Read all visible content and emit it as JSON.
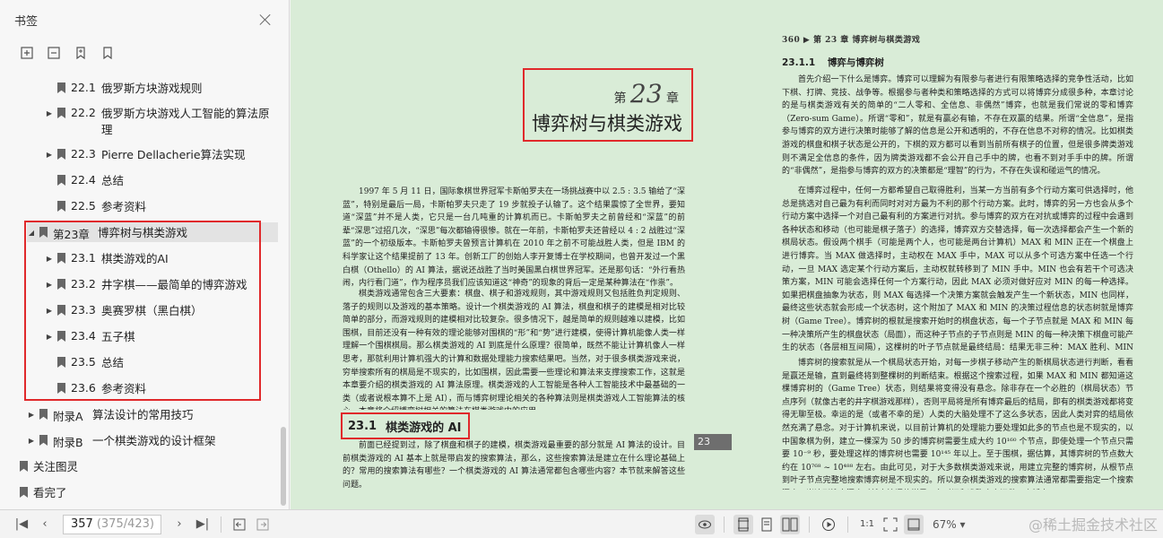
{
  "sidebar": {
    "title": "书签",
    "tools": [
      "expand-all-icon",
      "collapse-all-icon",
      "add-bookmark-icon",
      "bookmark-icon"
    ],
    "items": [
      {
        "num": "22.1",
        "label": "俄罗斯方块游戏规则",
        "level": 2,
        "arrow": false
      },
      {
        "num": "22.2",
        "label": "俄罗斯方块游戏人工智能的算法原理",
        "level": 2,
        "arrow": true
      },
      {
        "num": "22.3",
        "label": "Pierre Dellacherie算法实现",
        "level": 2,
        "arrow": true
      },
      {
        "num": "22.4",
        "label": "总结",
        "level": 2,
        "arrow": false
      },
      {
        "num": "22.5",
        "label": "参考资料",
        "level": 2,
        "arrow": false
      },
      {
        "num": "第23章",
        "label": "博弈树与棋类游戏",
        "level": 1,
        "arrow": "down",
        "selected": true
      },
      {
        "num": "23.1",
        "label": "棋类游戏的AI",
        "level": 2,
        "arrow": true
      },
      {
        "num": "23.2",
        "label": "井字棋——最简单的博弈游戏",
        "level": 2,
        "arrow": true
      },
      {
        "num": "23.3",
        "label": "奥赛罗棋（黑白棋）",
        "level": 2,
        "arrow": true
      },
      {
        "num": "23.4",
        "label": "五子棋",
        "level": 2,
        "arrow": true
      },
      {
        "num": "23.5",
        "label": "总结",
        "level": 2,
        "arrow": false
      },
      {
        "num": "23.6",
        "label": "参考资料",
        "level": 2,
        "arrow": false
      },
      {
        "num": "附录A",
        "label": "算法设计的常用技巧",
        "level": 1,
        "arrow": true
      },
      {
        "num": "附录B",
        "label": "一个棋类游戏的设计框架",
        "level": 1,
        "arrow": true
      },
      {
        "num": "",
        "label": "关注图灵",
        "level": 0,
        "arrow": false
      },
      {
        "num": "",
        "label": "看完了",
        "level": 0,
        "arrow": false
      }
    ]
  },
  "doc": {
    "chapter_prefix": "第",
    "chapter_num": "23",
    "chapter_suffix": "章",
    "chapter_title": "博弈树与棋类游戏",
    "left_paragraphs": [
      "1997 年 5 月 11 日，国际象棋世界冠军卡斯帕罗夫在一场挑战赛中以 2.5 : 3.5 输给了“深蓝”，特别是最后一局，卡斯帕罗夫只走了 19 步就投子认输了。这个结果震惊了全世界，要知道“深蓝”并不是人类，它只是一台几吨重的计算机而已。卡斯帕罗夫之前曾经和“深蓝”的前辈“深思”过招几次，“深思”每次都输得很惨。就在一年前，卡斯帕罗夫还曾经以 4 : 2 战胜过“深蓝”的一个初级版本。卡斯帕罗夫曾预言计算机在 2010 年之前不可能战胜人类，但是 IBM 的科学家让这个结果提前了 13 年。创新工厂的创始人李开复博士在学校期间，也曾开发过一个黑白棋（Othello）的 AI 算法，据说还战胜了当时美国黑白棋世界冠军。还是那句话：“外行看热闹，内行看门道”，作为程序员我们应该知道这“神奇”的现象的背后一定是某种算法在“作祟”。",
      "棋类游戏通常包含三大要素：棋盘、棋子和游戏规则，其中游戏规则又包括胜负判定规则、落子的规则以及游戏的基本策略。设计一个棋类游戏的 AI 算法，棋盘和棋子的建模是相对比较简单的部分，而游戏规则的建模相对比较复杂。很多情况下，越是简单的规则越难以建模，比如围棋，目前还没有一种有效的理论能够对围棋的“形”和“势”进行建模，使得计算机能像人类一样理解一个围棋棋局。那么棋类游戏的 AI 到底是什么原理？很简单，既然不能让计算机像人一样思考，那就利用计算机强大的计算和数据处理能力搜索结果吧。当然，对于很多棋类游戏来说，穷举搜索所有的棋局是不现实的，比如围棋，因此需要一些理论和算法来支撑搜索工作，这就是本章要介绍的棋类游戏的 AI 算法原理。棋类游戏的人工智能是各种人工智能技术中最基础的一类（或者说根本算不上是 AI），而与博弈树理论相关的各种算法则是棋类游戏人工智能算法的核心，本章将介绍博弈树相关的算法在棋类游戏中的应用。"
    ],
    "section_num": "23.1",
    "section_title": "棋类游戏的 AI",
    "section_para": "前面已经提到过，除了棋盘和棋子的建模，棋类游戏最重要的部分就是 AI 算法的设计。目前棋类游戏的 AI 基本上就是带启发的搜索算法，那么，这些搜索算法是建立在什么理论基础上的？常用的搜索算法有哪些？一个棋类游戏的 AI 算法通常都包含哪些内容？本节就来解答这些问题。",
    "tab_label": "23",
    "right_header": "360  ▶  第 23 章   博弈树与棋类游戏",
    "right_section_num": "23.1.1",
    "right_section_title": "博弈与博弈树",
    "right_paragraphs": [
      "首先介绍一下什么是博弈。博弈可以理解为有限参与者进行有限策略选择的竞争性活动，比如下棋、打牌、竞技、战争等。根据参与者种类和策略选择的方式可以将博弈分成很多种，本章讨论的是与棋类游戏有关的简单的“二人零和、全信息、非偶然”博弈，也就是我们常说的零和博弈（Zero-sum Game）。所谓“零和”，就是有赢必有输，不存在双赢的结果。所谓“全信息”，是指参与博弈的双方进行决策时能够了解的信息是公开和透明的，不存在信息不对称的情况。比如棋类游戏的棋盘和棋子状态是公开的，下棋的双方都可以看到当前所有棋子的位置，但是很多牌类游戏则不满足全信息的条件，因为牌类游戏都不会公开自己手中的牌，也看不到对手手中的牌。所谓的“非偶然”，是指参与博弈的双方的决策都是“理智”的行为，不存在失误和碰运气的情况。",
      "在博弈过程中，任何一方都希望自己取得胜利，当某一方当前有多个行动方案可供选择时，他总是挑选对自己最为有利而同时对对方最为不利的那个行动方案。此时，博弈的另一方也会从多个行动方案中选择一个对自己最有利的方案进行对抗。参与博弈的双方在对抗或博弈的过程中会遇到各种状态和移动（也可能是棋子落子）的选择，博弈双方交替选择，每一次选择都会产生一个新的棋局状态。假设两个棋手（可能是两个人，也可能是两台计算机）MAX 和 MIN 正在一个棋盘上进行博弈。当 MAX 做选择时，主动权在 MAX 手中，MAX 可以从多个可选方案中任选一个行动，一旦 MAX 选定某个行动方案后，主动权就转移到了 MIN 手中。MIN 也会有若干个可选决策方案，MIN 可能会选择任何一个方案行动，因此 MAX 必须对做好应对 MIN 的每一种选择。如果把棋盘抽象为状态，则 MAX 每选择一个决策方案就会触发产生一个新状态，MIN 也同样，最终这些状态就会形成一个状态树，这个附加了 MAX 和 MIN 的决策过程信息的状态树就是博弈树（Game Tree）。博弈树的根就是搜索开始时的棋盘状态，每一个子节点就是 MAX 和 MIN 每一种决策所产生的棋盘状态（局面），而这种子节点的子节点则是 MIN 的每一种决策下棋盘可能产生的状态（各层相互间隔），这棵树的叶子节点就是最终结局：结果无非三种：MAX 胜利、MIN 胜利或者平局。",
      "博弈树的搜索就是从一个棋局状态开始，对每一步棋子移动产生的新棋局状态进行判断，看看是赢还是输，直到最终将到整棵树的判断结束。根据这个搜索过程，如果 MAX 和 MIN 都知道这棵博弈树的（Game Tree）状态，则结果将变得没有悬念。除非存在一个必胜的（棋局状态）节点序列（就像古老的井字棋游戏那样），否则平局将是所有博弈最后的结局，即有的棋类游戏都将变得无聊至极。幸运的是（或者不幸的是）人类的大脑处理不了这么多状态，因此人类对弈的结局依然充满了悬念。对于计算机来说，以目前计算机的处理能力要处理如此多的节点也是不现实的，以中国象棋为例，建立一棵深为 50 步的博弈树需要生成大约 10¹⁶⁰ 个节点，即使处理一个节点只需要 10⁻⁹ 秒，要处理这样的博弈树也需要 10¹⁴⁵ 年以上。至于围棋，据估算，其博弈树的节点数大约在 10⁷⁶⁸ ~ 10⁴⁸⁸ 左右。由此可见，对于大多数棋类游戏来说，用建立完整的博弈树，从根节点到叶子节点完整地搜索博弈树是不现实的。所以复杂棋类游戏的搜索算法通常都需要指定一个搜索深度，当达到搜索深度时就直接评估棋局，在时间和准确度之间做一个折中。"
    ]
  },
  "statusbar": {
    "page_current": "357",
    "page_total": "(375/423)",
    "zoom": "67%",
    "watermark": "@稀土掘金技术社区"
  }
}
